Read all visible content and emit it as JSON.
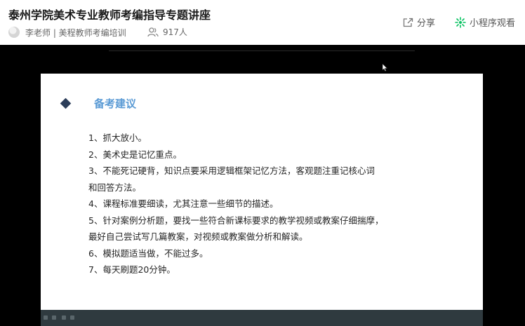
{
  "header": {
    "title": "泰州学院美术专业教师考编指导专题讲座",
    "author": "李老师 | 美程教师考编培训",
    "viewers": "917人",
    "share_label": "分享",
    "miniprogram_label": "小程序观看"
  },
  "slide": {
    "heading": "备考建议",
    "lines": [
      "1、抓大放小。",
      "2、美术史是记忆重点。",
      "3、不能死记硬背，知识点要采用逻辑框架记忆方法，客观题注重记核心词",
      "和回答方法。",
      "4、课程标准要细读，尤其注意一些细节的描述。",
      "5、针对案例分析题，要找一些符合新课标要求的教学视频或教案仔细揣摩，",
      "最好自己尝试写几篇教案，对视频或教案做分析和解读。",
      "6、模拟题适当做，不能过多。",
      "7、每天刷题20分钟。"
    ]
  },
  "colors": {
    "heading": "#5b9bd5",
    "bullet": "#2c3e5a",
    "wechat_green": "#07c160"
  }
}
